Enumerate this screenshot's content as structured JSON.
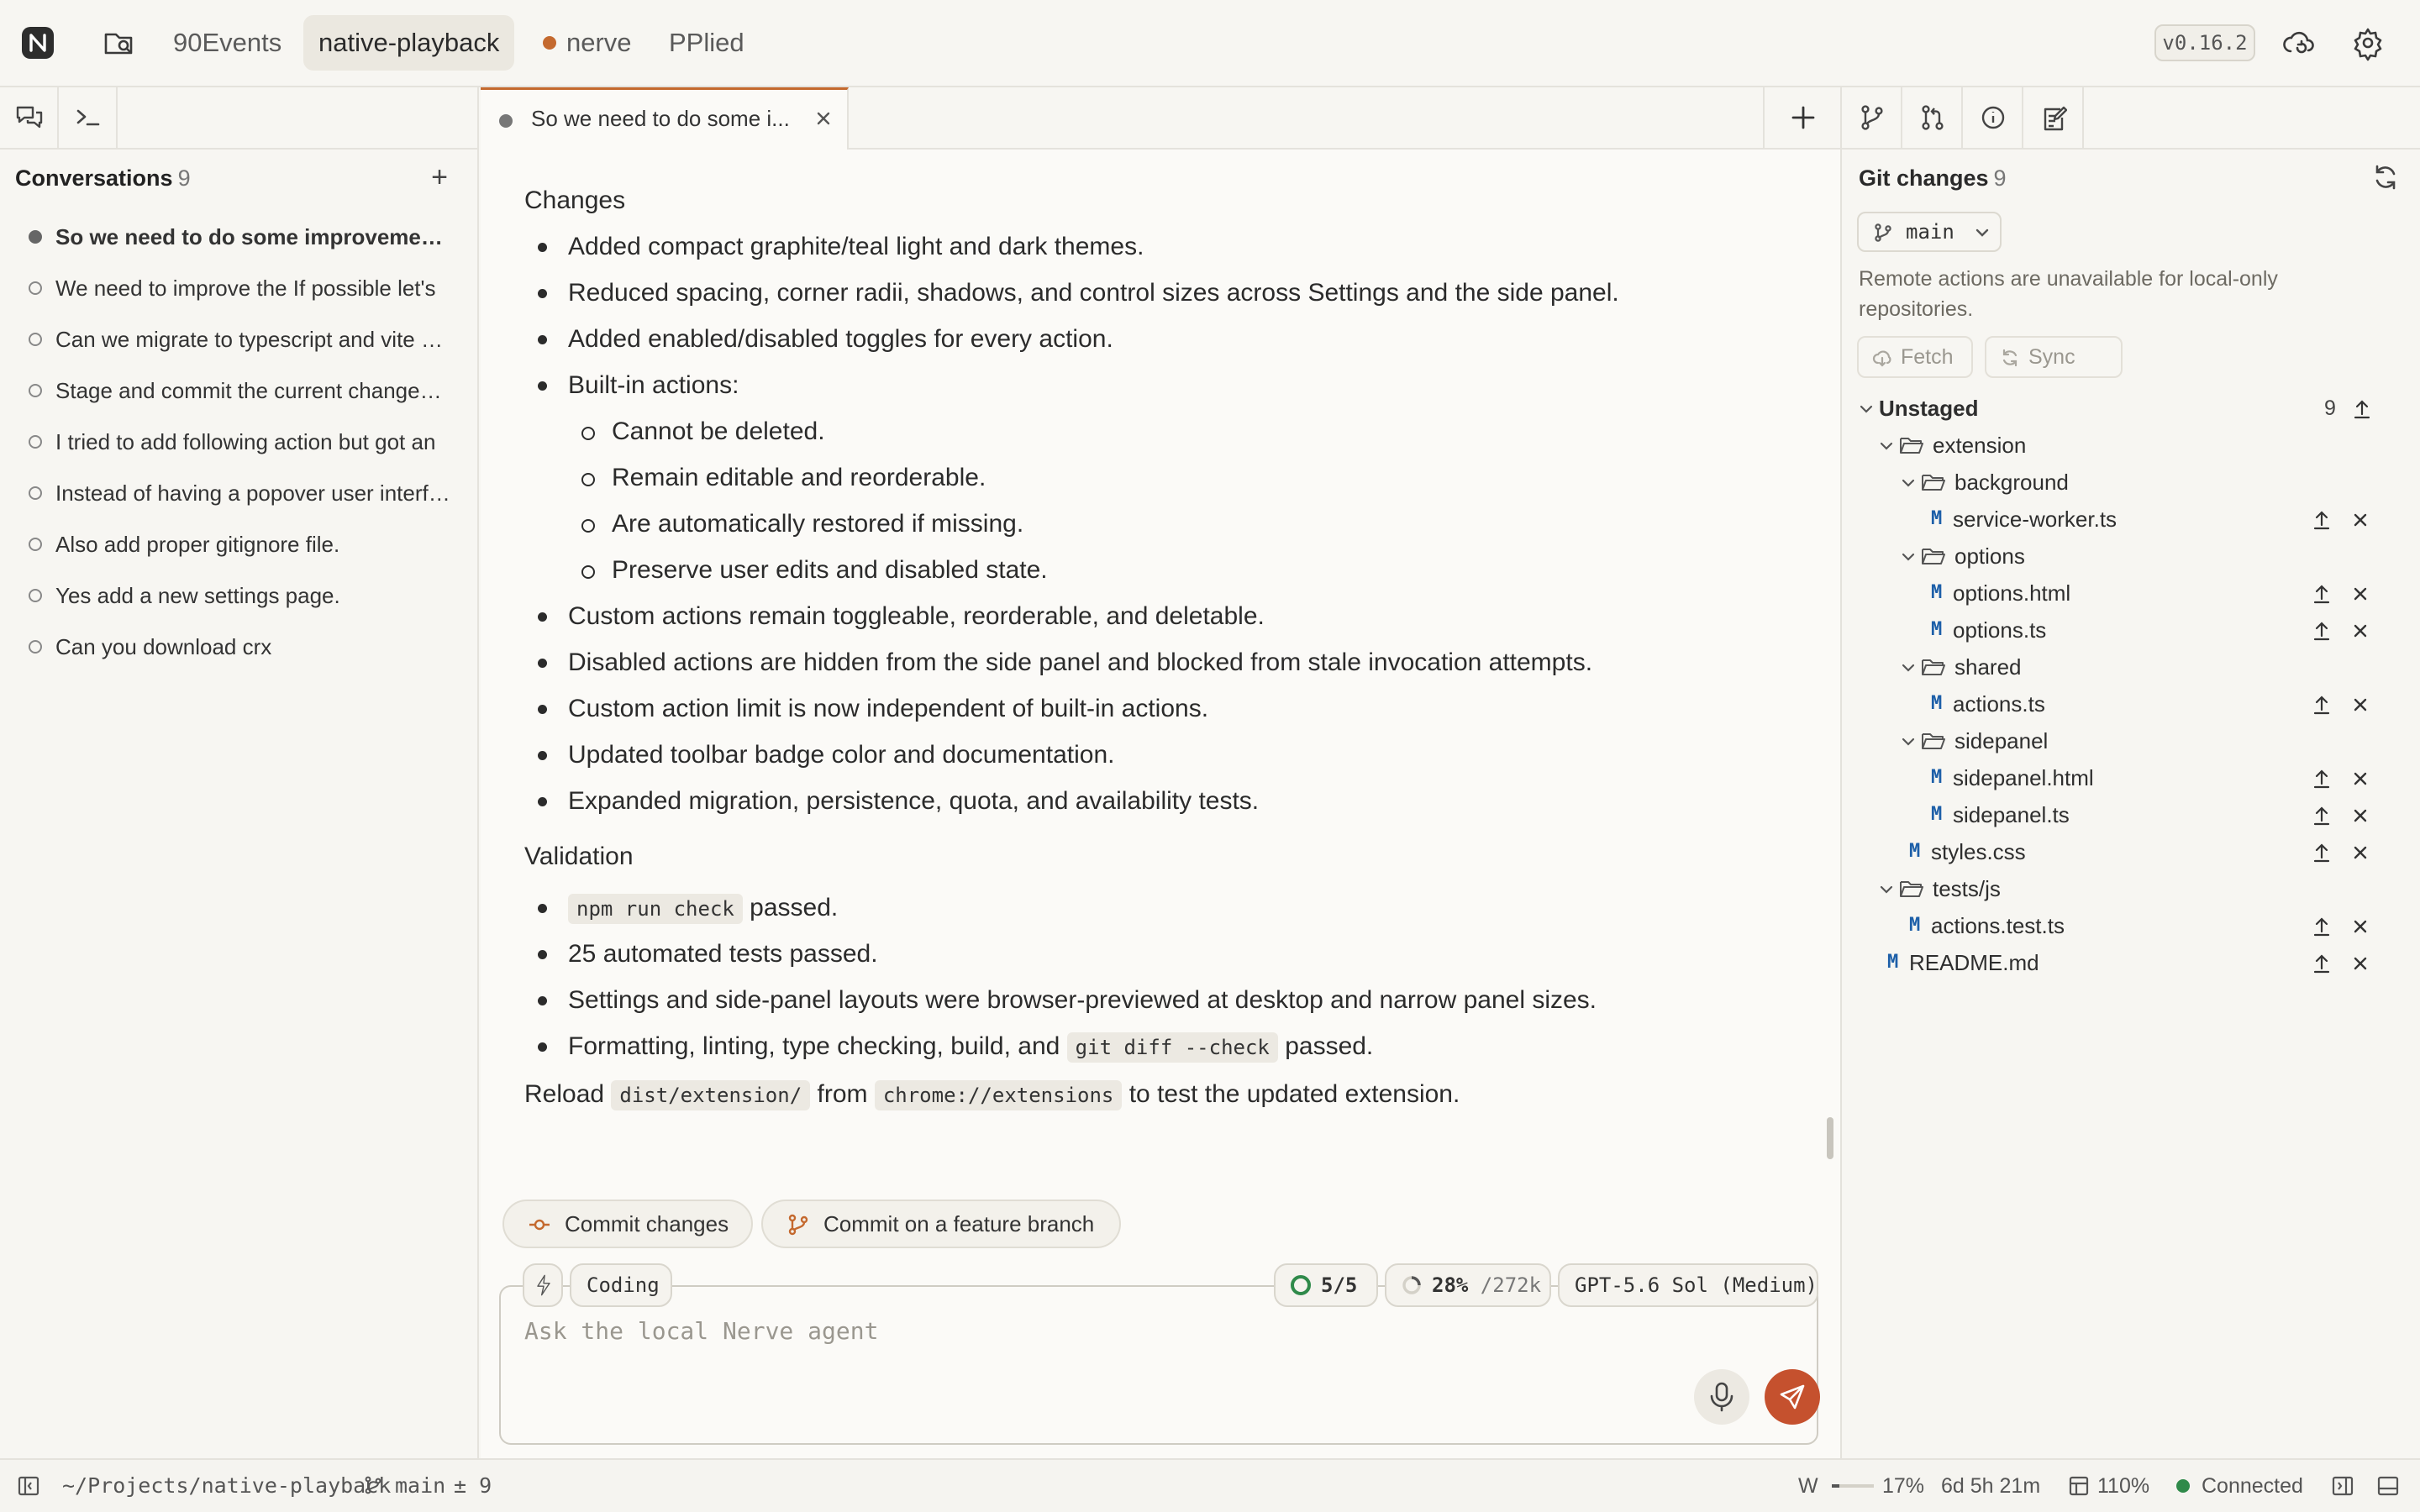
{
  "topbar": {
    "projects": [
      {
        "label": "90Events",
        "active": false,
        "dot": false
      },
      {
        "label": "native-playback",
        "active": true,
        "dot": false
      },
      {
        "label": "nerve",
        "active": false,
        "dot": true
      },
      {
        "label": "PPlied",
        "active": false,
        "dot": false
      }
    ],
    "version": "v0.16.2"
  },
  "conversations": {
    "title": "Conversations",
    "count": "9",
    "items": [
      {
        "label": "So we need to do some improvements, and also some",
        "active": true
      },
      {
        "label": "We need to improve the If possible let's",
        "active": false
      },
      {
        "label": "Can we migrate to typescript and vite and",
        "active": false
      },
      {
        "label": "Stage and commit the current changes and",
        "active": false
      },
      {
        "label": "I tried to add following action but got an",
        "active": false
      },
      {
        "label": "Instead of having a popover user interface",
        "active": false
      },
      {
        "label": "Also add proper gitignore file.",
        "active": false
      },
      {
        "label": "Yes add a new settings page.",
        "active": false
      },
      {
        "label": "Can you download crx",
        "active": false
      }
    ]
  },
  "chat": {
    "tab_title": "So we need to do some i...",
    "changes_heading": "Changes",
    "changes": [
      {
        "text": "Added compact graphite/teal light and dark themes.",
        "sub": false
      },
      {
        "text": "Reduced spacing, corner radii, shadows, and control sizes across Settings and the side panel.",
        "sub": false
      },
      {
        "text": "Added enabled/disabled toggles for every action.",
        "sub": false
      },
      {
        "text": "Built-in actions:",
        "sub": false
      },
      {
        "text": "Cannot be deleted.",
        "sub": true
      },
      {
        "text": "Remain editable and reorderable.",
        "sub": true
      },
      {
        "text": "Are automatically restored if missing.",
        "sub": true
      },
      {
        "text": "Preserve user edits and disabled state.",
        "sub": true
      },
      {
        "text": "Custom actions remain toggleable, reorderable, and deletable.",
        "sub": false
      },
      {
        "text": "Disabled actions are hidden from the side panel and blocked from stale invocation attempts.",
        "sub": false
      },
      {
        "text": "Custom action limit is now independent of built-in actions.",
        "sub": false
      },
      {
        "text": "Updated toolbar badge color and documentation.",
        "sub": false
      },
      {
        "text": "Expanded migration, persistence, quota, and availability tests.",
        "sub": false
      }
    ],
    "validation_heading": "Validation",
    "validation": {
      "v1_code": "npm run check",
      "v1_text": " passed.",
      "v2": "25 automated tests passed.",
      "v3": "Settings and side-panel layouts were browser-previewed at desktop and narrow panel sizes.",
      "v4_text": "Formatting, linting, type checking, build, and ",
      "v4_code": "git diff --check",
      "v4_tail": " passed."
    },
    "reload": {
      "t1": "Reload ",
      "c1": "dist/extension/",
      "t2": " from ",
      "c2": "chrome://extensions",
      "t3": " to test the updated extension."
    },
    "actions": {
      "commit": "Commit changes",
      "commit_branch": "Commit on a feature branch"
    }
  },
  "composer": {
    "mode": "Coding",
    "tasks": "5/5",
    "context_percent": "28%",
    "context_total": " /272k",
    "model": "GPT-5.6 Sol (Medium)",
    "placeholder": "Ask the local Nerve agent"
  },
  "git": {
    "title": "Git changes",
    "count": "9",
    "branch": "main",
    "remote_note": "Remote actions are unavailable for local-only repositories.",
    "fetch": "Fetch",
    "sync": "Sync",
    "unstaged_label": "Unstaged",
    "unstaged_count": "9",
    "tree": [
      {
        "kind": "folder",
        "name": "extension",
        "depth": 1
      },
      {
        "kind": "folder",
        "name": "background",
        "depth": 2
      },
      {
        "kind": "file",
        "name": "service-worker.ts",
        "depth": 3,
        "status": "M"
      },
      {
        "kind": "folder",
        "name": "options",
        "depth": 2
      },
      {
        "kind": "file",
        "name": "options.html",
        "depth": 3,
        "status": "M"
      },
      {
        "kind": "file",
        "name": "options.ts",
        "depth": 3,
        "status": "M"
      },
      {
        "kind": "folder",
        "name": "shared",
        "depth": 2
      },
      {
        "kind": "file",
        "name": "actions.ts",
        "depth": 3,
        "status": "M"
      },
      {
        "kind": "folder",
        "name": "sidepanel",
        "depth": 2
      },
      {
        "kind": "file",
        "name": "sidepanel.html",
        "depth": 3,
        "status": "M"
      },
      {
        "kind": "file",
        "name": "sidepanel.ts",
        "depth": 3,
        "status": "M"
      },
      {
        "kind": "file",
        "name": "styles.css",
        "depth": 2,
        "status": "M"
      },
      {
        "kind": "folder",
        "name": "tests/js",
        "depth": 1
      },
      {
        "kind": "file",
        "name": "actions.test.ts",
        "depth": 2,
        "status": "M"
      },
      {
        "kind": "file",
        "name": "README.md",
        "depth": 1,
        "status": "M"
      }
    ]
  },
  "statusbar": {
    "path": "~/Projects/native-playback",
    "branch": "main",
    "changes": "± 9",
    "w_label": "W",
    "memory_percent": "17%",
    "memory_fraction": 0.17,
    "uptime": "6d 5h 21m",
    "zoom": "110%",
    "connection": "Connected"
  }
}
